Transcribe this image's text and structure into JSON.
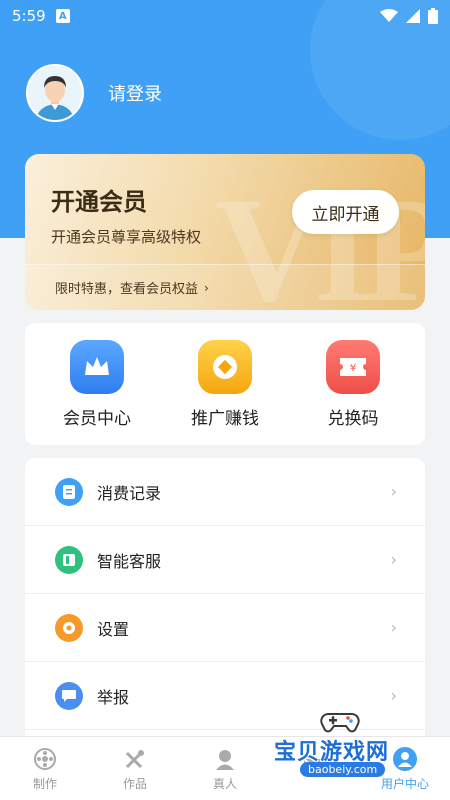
{
  "status": {
    "time": "5:59",
    "notification_letter": "A"
  },
  "profile": {
    "login_text": "请登录"
  },
  "vip": {
    "title": "开通会员",
    "subtitle": "开通会员尊享高级特权",
    "button": "立即开通",
    "footer": "限时特惠，查看会员权益",
    "watermark": "VIP"
  },
  "quick_actions": [
    {
      "label": "会员中心",
      "icon": "crown-icon",
      "color": "#3e8ff5"
    },
    {
      "label": "推广赚钱",
      "icon": "coin-icon",
      "color": "#f7b81c"
    },
    {
      "label": "兑换码",
      "icon": "ticket-icon",
      "color": "#f2635c"
    }
  ],
  "menu": [
    {
      "label": "消费记录",
      "icon": "receipt-icon",
      "color": "#3fa0f5"
    },
    {
      "label": "智能客服",
      "icon": "service-icon",
      "color": "#2ec27e"
    },
    {
      "label": "设置",
      "icon": "gear-icon",
      "color": "#f79a2a"
    },
    {
      "label": "举报",
      "icon": "report-icon",
      "color": "#4a8ef0"
    }
  ],
  "tabs": [
    {
      "label": "制作",
      "icon": "film-reel-icon",
      "active": false
    },
    {
      "label": "作品",
      "icon": "tools-icon",
      "active": false
    },
    {
      "label": "真人",
      "icon": "person-icon",
      "active": false
    },
    {
      "label": "",
      "icon": "mail-icon",
      "active": false
    },
    {
      "label": "用户中心",
      "icon": "user-icon",
      "active": true
    }
  ],
  "watermark": {
    "title": "宝贝游戏网",
    "url": "baobeiy.com"
  },
  "colors": {
    "primary": "#3fa0f5",
    "gold_dark": "#3b2c16"
  }
}
